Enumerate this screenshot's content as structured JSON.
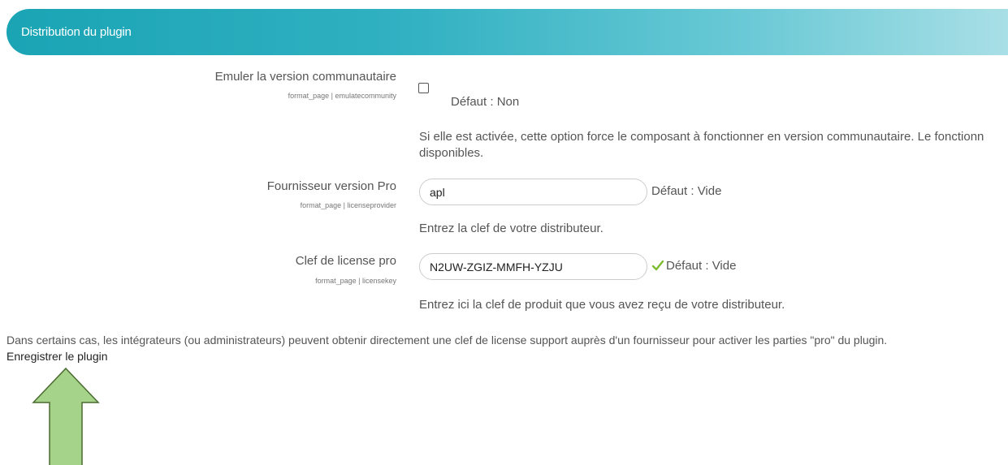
{
  "header": {
    "title": "Distribution du plugin"
  },
  "settings": [
    {
      "label": "Emuler la version communautaire",
      "key": "format_page | emulatecommunity",
      "default_text": "Défaut : Non",
      "description_line1": "Si elle est activée, cette option force le composant à fonctionner en version communautaire. Le fonctionn",
      "description_line2": "disponibles."
    },
    {
      "label": "Fournisseur version Pro",
      "key": "format_page | licenseprovider",
      "value": "apl",
      "default_text": "Défaut : Vide",
      "description": "Entrez la clef de votre distributeur."
    },
    {
      "label": "Clef de license pro",
      "key": "format_page | licensekey",
      "value": "N2UW-ZGIZ-MMFH-YZJU",
      "default_text": "Défaut : Vide",
      "description": "Entrez ici la clef de produit que vous avez reçu de votre distributeur."
    }
  ],
  "footer": {
    "note": "Dans certains cas, les intégrateurs (ou administrateurs) peuvent obtenir directement une clef de license support auprès d'un fournisseur pour activer les parties \"pro\" du plugin.",
    "register_link": "Enregistrer le plugin"
  },
  "colors": {
    "header_start": "#1aa4b4",
    "header_end": "#a9dfe6",
    "check": "#7cbd2e",
    "arrow_fill": "#a6d38a",
    "arrow_stroke": "#4a6b2f"
  },
  "icons": {
    "valid": "check-icon",
    "annotation": "up-arrow-icon"
  }
}
